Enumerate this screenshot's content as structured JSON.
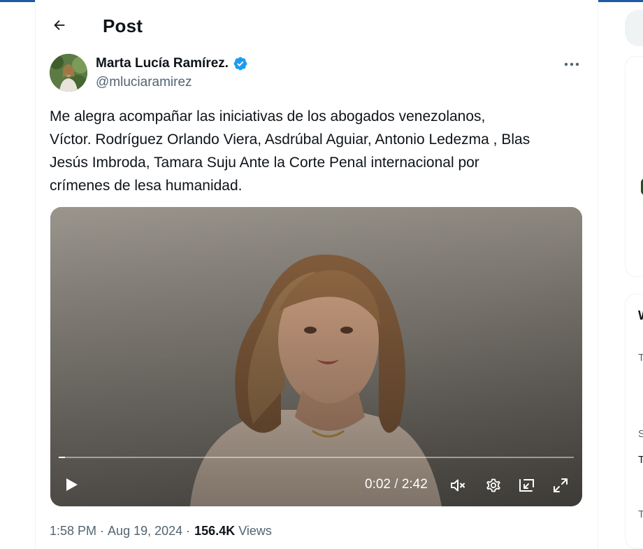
{
  "header": {
    "title": "Post"
  },
  "author": {
    "name": "Marta Lucía Ramírez.",
    "handle": "@mluciaramirez",
    "verified": true
  },
  "tweet": {
    "lines": [
      "Me alegra acompañar las iniciativas de los abogados venezolanos,",
      "Víctor. Rodríguez Orlando Viera, Asdrúbal Aguiar, Antonio Ledezma , Blas",
      "Jesús Imbroda, Tamara Suju Ante la Corte Penal internacional por",
      "crímenes de lesa humanidad."
    ]
  },
  "video": {
    "current_time": "0:02",
    "separator": "/",
    "duration": "2:42",
    "progress_fraction": 0.012
  },
  "meta": {
    "time": "1:58 PM",
    "dot1": "·",
    "date": "Aug 19, 2024",
    "dot2": "·",
    "views_count": "156.4K",
    "views_label": "Views"
  },
  "colors": {
    "accent_verified": "#1d9bf0",
    "text_primary": "#0f1419",
    "text_secondary": "#536471"
  },
  "icons": {
    "back": "arrow-left-icon",
    "verified": "verified-badge-icon",
    "more": "more-horizontal-icon",
    "play": "play-icon",
    "mute": "volume-muted-icon",
    "settings": "gear-icon",
    "pip": "picture-in-picture-icon",
    "fullscreen": "fullscreen-icon"
  },
  "right_sidebar": {
    "partial_letters": [
      "W",
      "T",
      "T",
      "S",
      "T"
    ]
  }
}
